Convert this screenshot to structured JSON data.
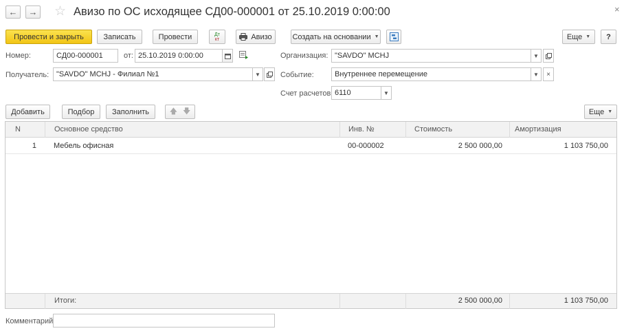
{
  "header": {
    "back_label": "←",
    "forward_label": "→",
    "title": "Авизо по ОС исходящее СД00-000001 от 25.10.2019 0:00:00",
    "close_label": "×"
  },
  "toolbar": {
    "post_close_label": "Провести и закрыть",
    "save_label": "Записать",
    "post_label": "Провести",
    "dtkt_top": "Дт",
    "dtkt_bottom": "кт",
    "print_label": "Авизо",
    "create_based_label": "Создать на основании",
    "more_label": "Еще",
    "help_label": "?"
  },
  "form": {
    "number_label": "Номер:",
    "number_value": "СД00-000001",
    "date_label": "от:",
    "date_value": "25.10.2019  0:00:00",
    "org_label": "Организация:",
    "org_value": "\"SAVDO\" MCHJ",
    "recipient_label": "Получатель:",
    "recipient_value": "\"SAVDO\" MCHJ - Филиал №1",
    "event_label": "Событие:",
    "event_value": "Внутреннее перемещение",
    "account_label": "Счет расчетов:",
    "account_value": "6110"
  },
  "table_toolbar": {
    "add_label": "Добавить",
    "select_label": "Подбор",
    "fill_label": "Заполнить",
    "more_label": "Еще"
  },
  "table": {
    "columns": [
      "N",
      "Основное средство",
      "Инв. №",
      "Стоимость",
      "Амортизация"
    ],
    "rows": [
      {
        "n": "1",
        "asset": "Мебель офисная",
        "inv": "00-000002",
        "cost": "2 500 000,00",
        "amort": "1 103 750,00"
      }
    ],
    "totals": {
      "label": "Итоги:",
      "cost": "2 500 000,00",
      "amort": "1 103 750,00"
    }
  },
  "comment": {
    "label": "Комментарий:",
    "value": ""
  }
}
